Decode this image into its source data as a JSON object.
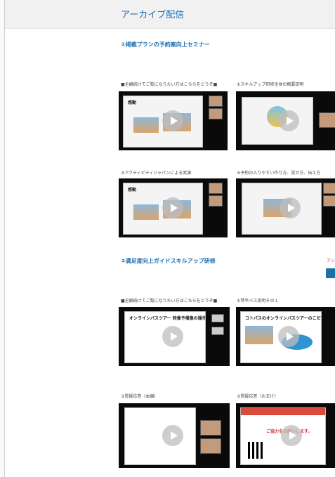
{
  "header": {
    "title": "アーカイブ配信"
  },
  "sections": [
    {
      "title": "①掲載プランの予約案向上セミナー",
      "videos": [
        {
          "caption": "■全編続けてご覧になりたい方はこちらをどうぞ■",
          "slide_text": "感動"
        },
        {
          "caption": "①スキルアップ研修全体の概要説明",
          "slide_text": ""
        },
        {
          "caption": "③アクティビティジャパンによる実演",
          "slide_text": "感動"
        },
        {
          "caption": "④予約の入りやすい作り方、見せ方、伝え方",
          "slide_text": ""
        }
      ]
    },
    {
      "title": "②満足度向上ガイドスキルアップ研修",
      "videos": [
        {
          "caption": "■全編続けてご覧になりたい方はこちらをどうぞ■",
          "slide_text": "オンラインバスツアー 映像予備像の操作"
        },
        {
          "caption": "①琴平バス説明その１",
          "slide_text": "コトバスのオンラインバスツアーのこだわり"
        },
        {
          "caption": "③質疑応答（本編）",
          "slide_text": ""
        },
        {
          "caption": "⑤質疑応答（おまけ）",
          "slide_text": "ご協力をお願いします。"
        }
      ]
    }
  ],
  "edge": {
    "tag": "アン"
  }
}
